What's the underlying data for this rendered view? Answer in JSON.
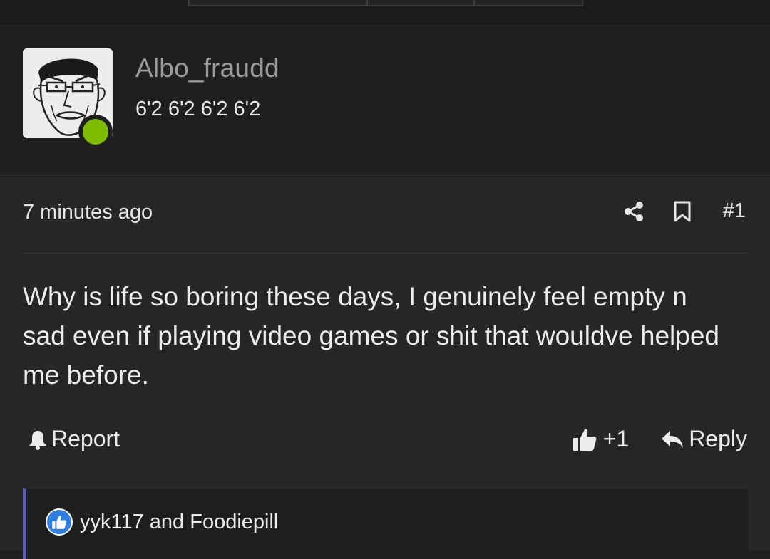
{
  "user": {
    "name": "Albo_fraudd",
    "title": "6'2 6'2 6'2 6'2",
    "online_color": "#7dbb00"
  },
  "post": {
    "time": "7 minutes ago",
    "number": "#1",
    "body": "Why is life so boring these days, I genuinely feel empty n sad even if playing video games or shit that wouldve helped me before."
  },
  "actions": {
    "report_label": "Report",
    "like_count": "+1",
    "reply_label": "Reply"
  },
  "likes": {
    "text": "yyk117 and Foodiepill"
  },
  "icons": {
    "share": "share-icon",
    "bookmark": "bookmark-icon",
    "report": "bell-icon",
    "like": "thumbs-up-icon",
    "reply": "reply-arrow-icon"
  }
}
